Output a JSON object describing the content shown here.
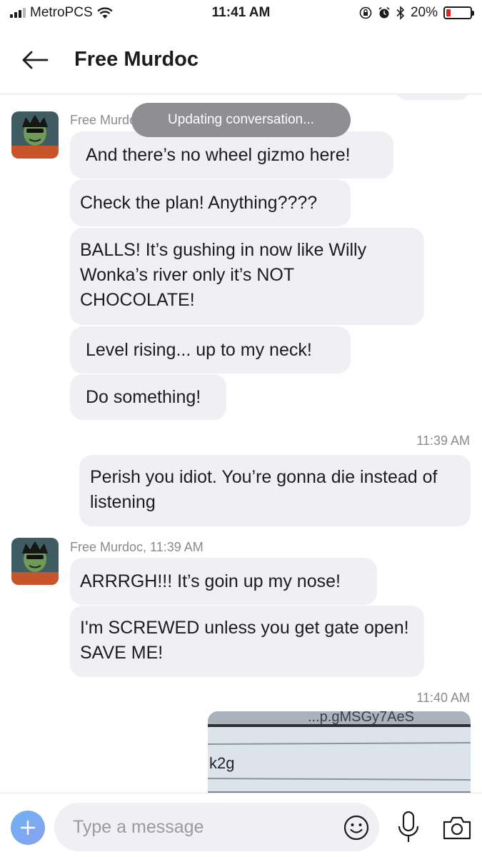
{
  "status_bar": {
    "carrier": "MetroPCS",
    "time": "11:41 AM",
    "battery_percent": "20%",
    "battery_level": 0.2,
    "icons": [
      "signal-icon",
      "wifi-icon",
      "rotation-lock-icon",
      "alarm-icon",
      "bluetooth-icon",
      "battery-icon"
    ]
  },
  "header": {
    "title": "Free Murdoc",
    "back_icon": "back-arrow-icon"
  },
  "toast": "Updating conversation...",
  "messages": {
    "group1": {
      "sender_label": "Free Murdoc",
      "bubbles": [
        "And there’s no wheel gizmo here!",
        "Check the plan! Anything????",
        "BALLS! It’s gushing in now like Willy Wonka’s river only it’s NOT CHOCOLATE!",
        "Level rising... up to my neck!",
        "Do something!"
      ]
    },
    "time1": "11:39 AM",
    "outgoing1": "Perish you idiot. You’re gonna die instead of listening",
    "group2": {
      "sender_label": "Free Murdoc, 11:39 AM",
      "bubbles": [
        "ARRRGH!!! It’s goin up my nose!",
        "I'm SCREWED unless you get gate open! SAVE ME!"
      ]
    },
    "time2": "11:40 AM",
    "photo_text": {
      "top": "...p.gMSGy7AeS",
      "label": "k2g"
    }
  },
  "composer": {
    "placeholder": "Type a message",
    "icons": [
      "add-icon",
      "emoji-icon",
      "microphone-icon",
      "camera-icon"
    ]
  },
  "colors": {
    "bubble": "#efeff4",
    "toast": "#8e8e93",
    "battery_low": "#e5231e",
    "accent": "#6db3f2"
  }
}
